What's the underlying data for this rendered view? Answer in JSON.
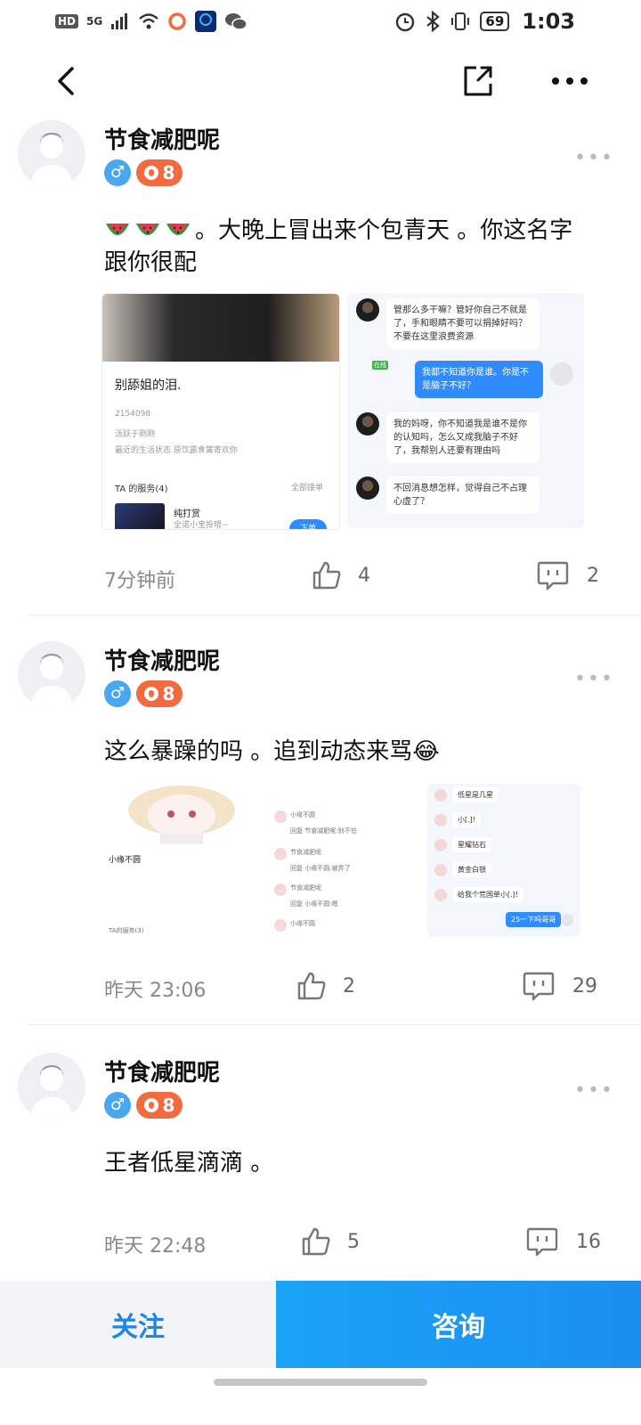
{
  "status_bar": {
    "hd": "HD",
    "network": "5G",
    "battery": "69",
    "time": "1:03"
  },
  "posts": [
    {
      "username": "节食减肥呢",
      "level": "8",
      "text": "。大晚上冒出来个包青天 。你这名字跟你很配",
      "time": "7分钟前",
      "likes": "4",
      "comments": "2",
      "images": {
        "profile_card": {
          "name": "别舔姐的泪.",
          "id_line": "2154098",
          "line2": "活跃于刚刚",
          "line3": "最近的生活状态 原饮露食簧寄欢你",
          "section": "TA 的服务(4)",
          "all": "全部接单",
          "service": "纯打赏",
          "service_sub": "全诺小宝投喂~",
          "order": "下单"
        },
        "chat": {
          "msg1": "管那么多干嘛？管好你自己不就是了，手和眼睛不要可以捐掉好吗？不要在这里浪费资源",
          "tag": "在线",
          "msg2": "我都不知道你是谁。你是不是脑子不好？",
          "msg3": "我的妈呀，你不知道我是谁不是你的认知吗，怎么又成我脑子不好了，我帮别人还要有理由吗",
          "msg4": "不回消息想怎样，觉得自己不占理心虚了？"
        }
      }
    },
    {
      "username": "节食减肥呢",
      "level": "8",
      "text": "这么暴躁的吗 。追到动态来骂😂",
      "time": "昨天 23:06",
      "likes": "2",
      "comments": "29",
      "images": {
        "card_name": "小缘不圆",
        "card_section": "TA的服务(3)",
        "list_names": [
          "小缘不圆",
          "节食减肥呢",
          "节食减肥呢",
          "小缘不圆"
        ],
        "list_replies": [
          "回复 节食减肥呢:别不怕",
          "回复 小缘不圆:被弄了",
          "回复 小缘不圆:嗯"
        ],
        "chat_msgs": [
          "低星是几星",
          "小[.]!",
          "星耀钻石",
          "黄金白银",
          "给我个荒国单小[.]!"
        ],
        "chat_me": "25一下吗哥哥"
      }
    },
    {
      "username": "节食减肥呢",
      "level": "8",
      "text": "王者低星滴滴 。",
      "time": "昨天 22:48",
      "likes": "5",
      "comments": "16"
    }
  ],
  "bottom": {
    "follow": "关注",
    "consult": "咨询"
  },
  "colors": {
    "accent_blue": "#1b8ef0",
    "level_orange": "#f26a3d",
    "sex_blue": "#49a7f2"
  }
}
